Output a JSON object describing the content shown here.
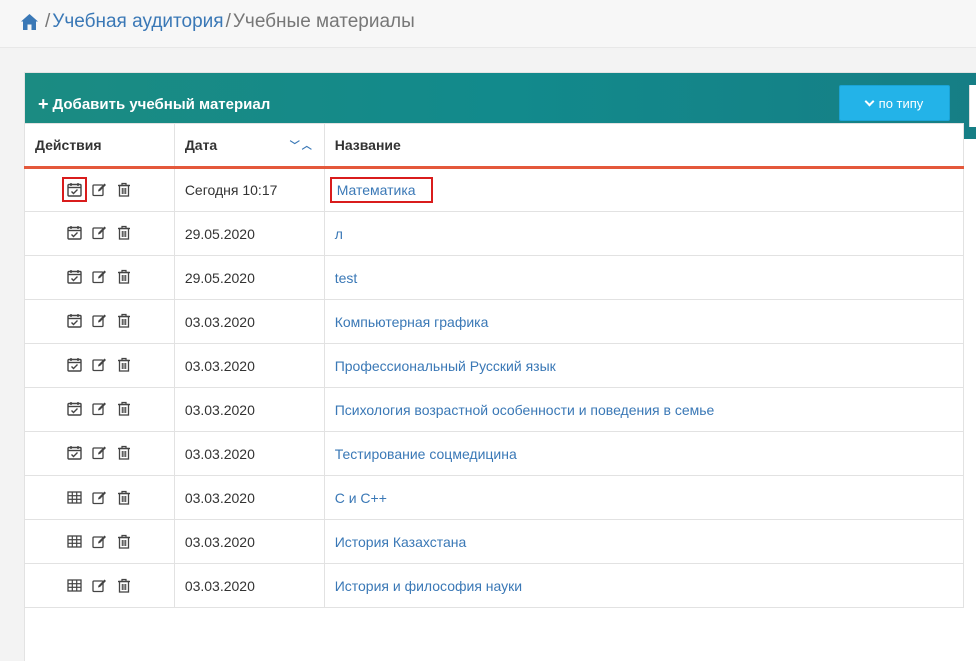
{
  "breadcrumb": {
    "home_icon": "home-icon",
    "items": [
      "Учебная аудитория",
      "Учебные материалы"
    ],
    "separator": "/"
  },
  "toolbar": {
    "add_label": "Добавить учебный материал",
    "add_icon": "plus-icon",
    "type_label": "по типу",
    "type_icon": "chevron-down-icon"
  },
  "table": {
    "headers": {
      "actions": "Действия",
      "date": "Дата",
      "name": "Название"
    },
    "rows": [
      {
        "icon": "calendar-check-icon",
        "date": "Сегодня 10:17",
        "name": "Математика"
      },
      {
        "icon": "calendar-check-icon",
        "date": "29.05.2020",
        "name": "л"
      },
      {
        "icon": "calendar-check-icon",
        "date": "29.05.2020",
        "name": "test"
      },
      {
        "icon": "calendar-check-icon",
        "date": "03.03.2020",
        "name": "Компьютерная графика"
      },
      {
        "icon": "calendar-check-icon",
        "date": "03.03.2020",
        "name": "Профессиональный Русский язык"
      },
      {
        "icon": "calendar-check-icon",
        "date": "03.03.2020",
        "name": "Психология возрастной особенности и поведения в семье"
      },
      {
        "icon": "calendar-check-icon",
        "date": "03.03.2020",
        "name": "Тестирование соцмедицина"
      },
      {
        "icon": "table-icon",
        "date": "03.03.2020",
        "name": "C и C++"
      },
      {
        "icon": "table-icon",
        "date": "03.03.2020",
        "name": "История Казахстана"
      },
      {
        "icon": "table-icon",
        "date": "03.03.2020",
        "name": "История и философия науки"
      }
    ]
  },
  "colors": {
    "toolbar": "#128a8c",
    "type_button": "#23b3e8",
    "link": "#3a78b6",
    "header_underline": "#e4583b",
    "highlight": "#d91c1c"
  }
}
